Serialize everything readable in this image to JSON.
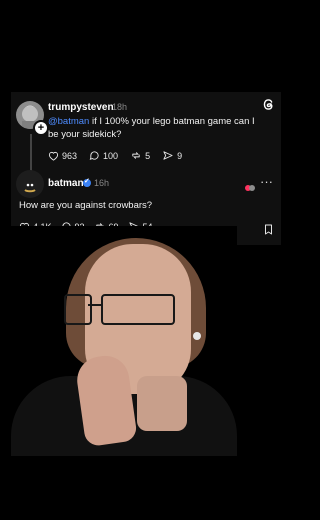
{
  "post_parent": {
    "username": "trumpysteven",
    "time": "18h",
    "mention": "@batman",
    "text_rest": " if I 100% your lego batman game can I be your sidekick?",
    "stats": {
      "likes": "963",
      "replies": "100",
      "reposts": "5",
      "shares": "9"
    }
  },
  "post_reply": {
    "username": "batman",
    "time": "16h",
    "text": "How are you against crowbars?",
    "stats": {
      "likes": "4.1K",
      "replies": "93",
      "reposts": "69",
      "shares": "54"
    }
  },
  "icons": {
    "threads_logo": "threads-logo-icon",
    "more": "more-options-icon",
    "heart": "heart-icon",
    "comment": "comment-icon",
    "repost": "repost-icon",
    "share": "share-icon",
    "bookmark": "bookmark-icon"
  },
  "colors": {
    "mention": "#4e8cff",
    "verified": "#3b82f6",
    "card_bg": "#101010"
  }
}
